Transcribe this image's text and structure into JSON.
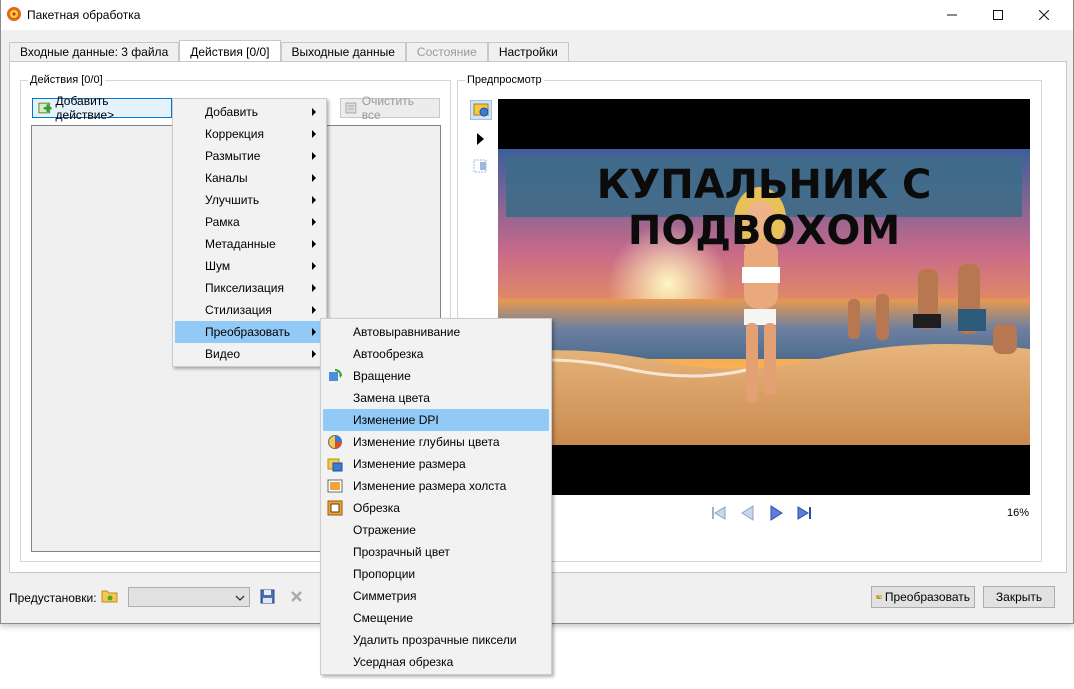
{
  "window": {
    "title": "Пакетная обработка"
  },
  "tabs": [
    {
      "label": "Входные данные: 3 файла",
      "state": "normal"
    },
    {
      "label": "Действия [0/0]",
      "state": "active"
    },
    {
      "label": "Выходные данные",
      "state": "normal"
    },
    {
      "label": "Состояние",
      "state": "disabled"
    },
    {
      "label": "Настройки",
      "state": "normal"
    }
  ],
  "actions_panel": {
    "group_label": "Действия [0/0]",
    "add_action_label": "Добавить действие>",
    "clear_all_label": "Очистить все"
  },
  "preview_panel": {
    "group_label": "Предпросмотр",
    "image_banner_text": "КУПАЛЬНИК С ПОДВОХОМ",
    "zoom": "16%"
  },
  "bottom": {
    "presets_label": "Предустановки:",
    "preset_value": "",
    "convert_label": "Преобразовать",
    "close_label": "Закрыть"
  },
  "menu_main": {
    "items": [
      {
        "label": "Добавить"
      },
      {
        "label": "Коррекция"
      },
      {
        "label": "Размытие"
      },
      {
        "label": "Каналы"
      },
      {
        "label": "Улучшить"
      },
      {
        "label": "Рамка"
      },
      {
        "label": "Метаданные"
      },
      {
        "label": "Шум"
      },
      {
        "label": "Пикселизация"
      },
      {
        "label": "Стилизация"
      },
      {
        "label": "Преобразовать"
      },
      {
        "label": "Видео"
      }
    ]
  },
  "menu_sub": {
    "items": [
      {
        "label": "Автовыравнивание",
        "icon": ""
      },
      {
        "label": "Автообрезка",
        "icon": ""
      },
      {
        "label": "Вращение",
        "icon": "rotate-icon"
      },
      {
        "label": "Замена цвета",
        "icon": ""
      },
      {
        "label": "Изменение DPI",
        "icon": ""
      },
      {
        "label": "Изменение глубины цвета",
        "icon": "color-depth-icon"
      },
      {
        "label": "Изменение размера",
        "icon": "resize-icon"
      },
      {
        "label": "Изменение размера холста",
        "icon": "canvas-size-icon"
      },
      {
        "label": "Обрезка",
        "icon": "crop-icon"
      },
      {
        "label": "Отражение",
        "icon": ""
      },
      {
        "label": "Прозрачный цвет",
        "icon": ""
      },
      {
        "label": "Пропорции",
        "icon": ""
      },
      {
        "label": "Симметрия",
        "icon": ""
      },
      {
        "label": "Смещение",
        "icon": ""
      },
      {
        "label": "Удалить прозрачные пиксели",
        "icon": ""
      },
      {
        "label": "Усердная обрезка",
        "icon": ""
      }
    ]
  },
  "colors": {
    "menu_highlight": "#91c9f7",
    "accent": "#0078d7"
  }
}
